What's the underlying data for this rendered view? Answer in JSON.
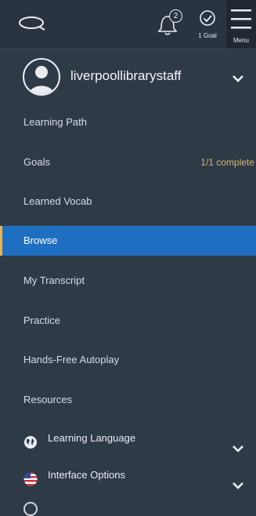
{
  "header": {
    "notifications_count": "2",
    "goal_label": "1 Goal",
    "menu_label": "Menu"
  },
  "user": {
    "name": "liverpoollibrarystaff"
  },
  "menu_items": [
    {
      "label": "Learning Path",
      "right": ""
    },
    {
      "label": "Goals",
      "right": "1/1 complete"
    },
    {
      "label": "Learned Vocab",
      "right": ""
    },
    {
      "label": "Browse",
      "right": "",
      "active": true
    },
    {
      "label": "My Transcript",
      "right": ""
    },
    {
      "label": "Practice",
      "right": ""
    },
    {
      "label": "Hands-Free Autoplay",
      "right": ""
    },
    {
      "label": "Resources",
      "right": ""
    }
  ],
  "sections": [
    {
      "label": "Learning Language",
      "icon": "globe-icon"
    },
    {
      "label": "Interface Options",
      "icon": "us-flag-icon"
    }
  ],
  "colors": {
    "background": "#2f3a47",
    "active_item": "#1e6fc2",
    "accent": "#d9b56c"
  }
}
